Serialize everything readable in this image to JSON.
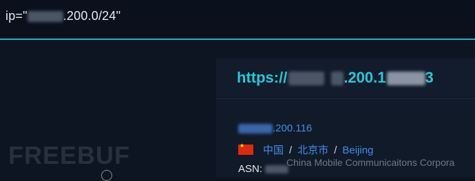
{
  "query": {
    "prefix": "ip=\"",
    "suffix": ".200.0/24\""
  },
  "result": {
    "url_prefix": "https://",
    "url_middle": ".200.1",
    "url_suffix": "3",
    "ip_suffix": ".200.116",
    "location": {
      "country": "中国",
      "city_cn": "北京市",
      "city_en": "Beijing",
      "separator": "/"
    },
    "asn_label": "ASN:",
    "organization": "China Mobile Communicaitons Corpora"
  },
  "watermark": "FREEBUF",
  "colors": {
    "accent": "#1fb7c0",
    "url": "#27c9d6",
    "link": "#3f8fe8"
  }
}
